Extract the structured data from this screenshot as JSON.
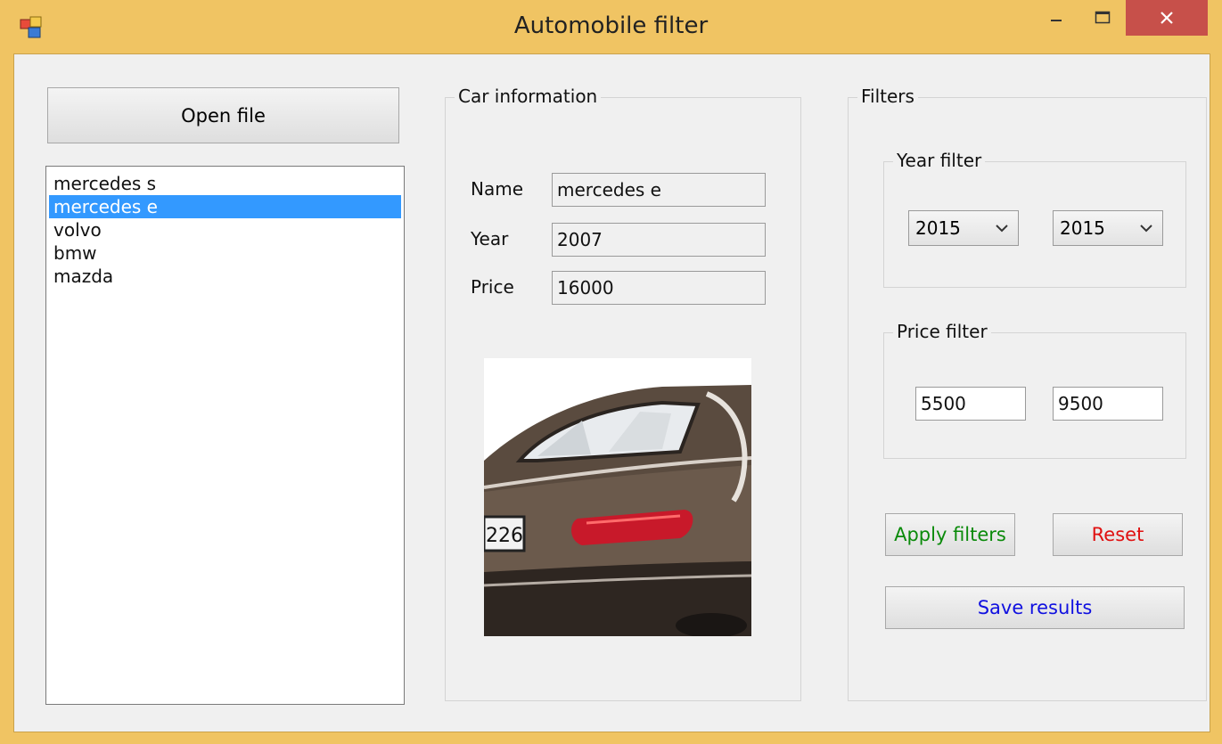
{
  "window": {
    "title": "Automobile filter",
    "icon": "app-window-icon",
    "controls": [
      "minimize-icon",
      "maximize-icon",
      "close-icon"
    ]
  },
  "open_file": {
    "label": "Open file"
  },
  "car_list": {
    "items": [
      "mercedes s",
      "mercedes e",
      "volvo",
      "bmw",
      "mazda"
    ],
    "selected_index": 1
  },
  "car_information": {
    "legend": "Car information",
    "name_label": "Name",
    "name_value": "mercedes e",
    "year_label": "Year",
    "year_value": "2007",
    "price_label": "Price",
    "price_value": "16000",
    "photo": "car-rear-photo"
  },
  "filters": {
    "legend": "Filters",
    "year_filter": {
      "legend": "Year filter",
      "from": "2015",
      "to": "2015"
    },
    "price_filter": {
      "legend": "Price filter",
      "min": "5500",
      "max": "9500"
    },
    "apply_label": "Apply filters",
    "reset_label": "Reset",
    "save_label": "Save results"
  },
  "colors": {
    "title_bar": "#f0c463",
    "selection": "#3399ff",
    "apply_text": "#0a8a0a",
    "reset_text": "#e01010",
    "save_text": "#1010e0",
    "close_button": "#c7504a"
  }
}
